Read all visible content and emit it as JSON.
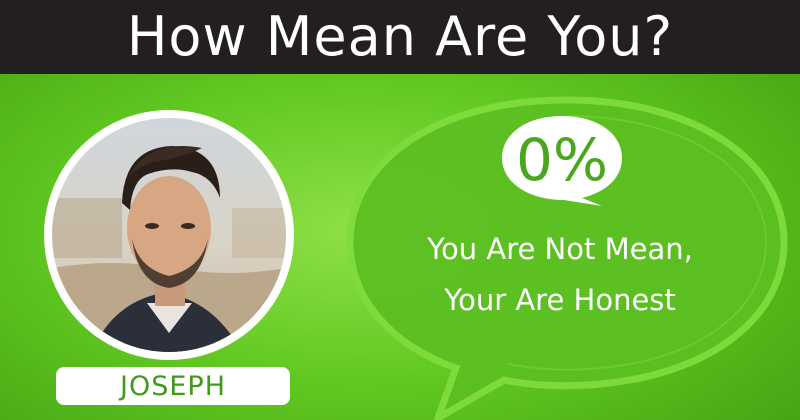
{
  "header": {
    "title": "How Mean Are You?"
  },
  "profile": {
    "name": "JOSEPH",
    "photo": "profile-photo"
  },
  "result": {
    "percent": "0%",
    "line1": "You Are Not Mean,",
    "line2": "Your Are Honest"
  },
  "colors": {
    "header_bg": "#231f20",
    "accent_green": "#4aa61f",
    "background_green": "#62c922",
    "text_white": "#ffffff"
  }
}
